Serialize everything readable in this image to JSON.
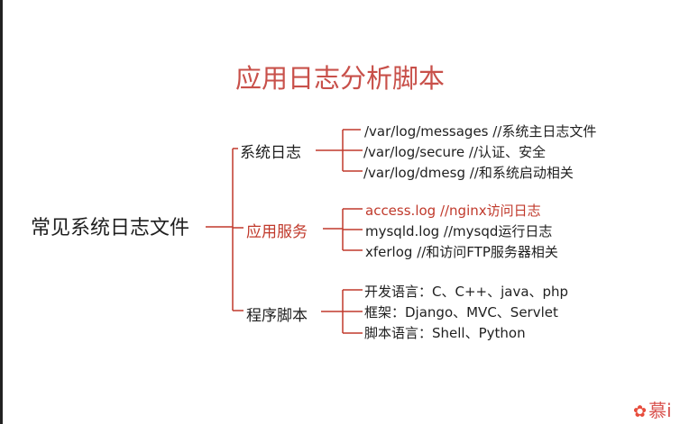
{
  "title": "应用日志分析脚本",
  "root": {
    "label": "常见系统日志文件"
  },
  "branches": [
    {
      "label": "系统日志",
      "highlight": false,
      "items": [
        " /var/log/messages  //系统主日志文件",
        "/var/log/secure  //认证、安全",
        " /var/log/dmesg   //和系统启动相关"
      ]
    },
    {
      "label": "应用服务",
      "highlight": true,
      "items": [
        "access.log   //nginx访问日志",
        "mysqld.log       //mysqd运行日志",
        "xferlog   //和访问FTP服务器相关"
      ]
    },
    {
      "label": "程序脚本",
      "highlight": false,
      "items": [
        " 开发语言：C、C++、java、php",
        "框架：Django、MVC、Servlet",
        "脚本语言：Shell、Python"
      ]
    }
  ],
  "logo": {
    "text": "慕i",
    "icon": "flame-icon"
  },
  "colors": {
    "title": "#c8504a",
    "highlight": "#c0392b",
    "line_red": "#c0392b",
    "line_dark": "#333333"
  }
}
